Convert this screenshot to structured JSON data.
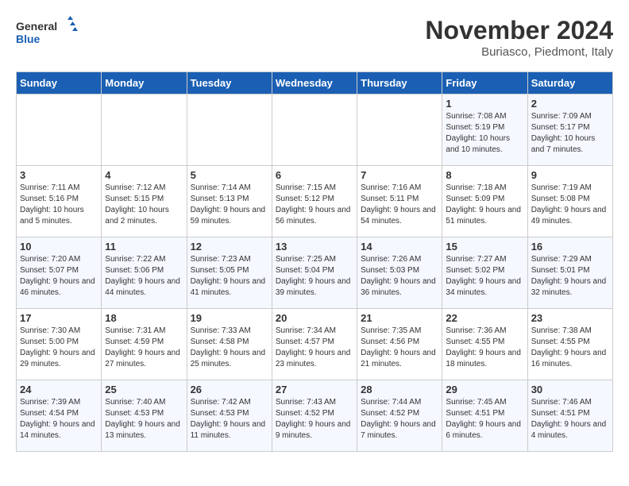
{
  "logo": {
    "line1": "General",
    "line2": "Blue"
  },
  "title": "November 2024",
  "location": "Buriasco, Piedmont, Italy",
  "days_of_week": [
    "Sunday",
    "Monday",
    "Tuesday",
    "Wednesday",
    "Thursday",
    "Friday",
    "Saturday"
  ],
  "weeks": [
    [
      {
        "day": "",
        "info": ""
      },
      {
        "day": "",
        "info": ""
      },
      {
        "day": "",
        "info": ""
      },
      {
        "day": "",
        "info": ""
      },
      {
        "day": "",
        "info": ""
      },
      {
        "day": "1",
        "info": "Sunrise: 7:08 AM\nSunset: 5:19 PM\nDaylight: 10 hours and 10 minutes."
      },
      {
        "day": "2",
        "info": "Sunrise: 7:09 AM\nSunset: 5:17 PM\nDaylight: 10 hours and 7 minutes."
      }
    ],
    [
      {
        "day": "3",
        "info": "Sunrise: 7:11 AM\nSunset: 5:16 PM\nDaylight: 10 hours and 5 minutes."
      },
      {
        "day": "4",
        "info": "Sunrise: 7:12 AM\nSunset: 5:15 PM\nDaylight: 10 hours and 2 minutes."
      },
      {
        "day": "5",
        "info": "Sunrise: 7:14 AM\nSunset: 5:13 PM\nDaylight: 9 hours and 59 minutes."
      },
      {
        "day": "6",
        "info": "Sunrise: 7:15 AM\nSunset: 5:12 PM\nDaylight: 9 hours and 56 minutes."
      },
      {
        "day": "7",
        "info": "Sunrise: 7:16 AM\nSunset: 5:11 PM\nDaylight: 9 hours and 54 minutes."
      },
      {
        "day": "8",
        "info": "Sunrise: 7:18 AM\nSunset: 5:09 PM\nDaylight: 9 hours and 51 minutes."
      },
      {
        "day": "9",
        "info": "Sunrise: 7:19 AM\nSunset: 5:08 PM\nDaylight: 9 hours and 49 minutes."
      }
    ],
    [
      {
        "day": "10",
        "info": "Sunrise: 7:20 AM\nSunset: 5:07 PM\nDaylight: 9 hours and 46 minutes."
      },
      {
        "day": "11",
        "info": "Sunrise: 7:22 AM\nSunset: 5:06 PM\nDaylight: 9 hours and 44 minutes."
      },
      {
        "day": "12",
        "info": "Sunrise: 7:23 AM\nSunset: 5:05 PM\nDaylight: 9 hours and 41 minutes."
      },
      {
        "day": "13",
        "info": "Sunrise: 7:25 AM\nSunset: 5:04 PM\nDaylight: 9 hours and 39 minutes."
      },
      {
        "day": "14",
        "info": "Sunrise: 7:26 AM\nSunset: 5:03 PM\nDaylight: 9 hours and 36 minutes."
      },
      {
        "day": "15",
        "info": "Sunrise: 7:27 AM\nSunset: 5:02 PM\nDaylight: 9 hours and 34 minutes."
      },
      {
        "day": "16",
        "info": "Sunrise: 7:29 AM\nSunset: 5:01 PM\nDaylight: 9 hours and 32 minutes."
      }
    ],
    [
      {
        "day": "17",
        "info": "Sunrise: 7:30 AM\nSunset: 5:00 PM\nDaylight: 9 hours and 29 minutes."
      },
      {
        "day": "18",
        "info": "Sunrise: 7:31 AM\nSunset: 4:59 PM\nDaylight: 9 hours and 27 minutes."
      },
      {
        "day": "19",
        "info": "Sunrise: 7:33 AM\nSunset: 4:58 PM\nDaylight: 9 hours and 25 minutes."
      },
      {
        "day": "20",
        "info": "Sunrise: 7:34 AM\nSunset: 4:57 PM\nDaylight: 9 hours and 23 minutes."
      },
      {
        "day": "21",
        "info": "Sunrise: 7:35 AM\nSunset: 4:56 PM\nDaylight: 9 hours and 21 minutes."
      },
      {
        "day": "22",
        "info": "Sunrise: 7:36 AM\nSunset: 4:55 PM\nDaylight: 9 hours and 18 minutes."
      },
      {
        "day": "23",
        "info": "Sunrise: 7:38 AM\nSunset: 4:55 PM\nDaylight: 9 hours and 16 minutes."
      }
    ],
    [
      {
        "day": "24",
        "info": "Sunrise: 7:39 AM\nSunset: 4:54 PM\nDaylight: 9 hours and 14 minutes."
      },
      {
        "day": "25",
        "info": "Sunrise: 7:40 AM\nSunset: 4:53 PM\nDaylight: 9 hours and 13 minutes."
      },
      {
        "day": "26",
        "info": "Sunrise: 7:42 AM\nSunset: 4:53 PM\nDaylight: 9 hours and 11 minutes."
      },
      {
        "day": "27",
        "info": "Sunrise: 7:43 AM\nSunset: 4:52 PM\nDaylight: 9 hours and 9 minutes."
      },
      {
        "day": "28",
        "info": "Sunrise: 7:44 AM\nSunset: 4:52 PM\nDaylight: 9 hours and 7 minutes."
      },
      {
        "day": "29",
        "info": "Sunrise: 7:45 AM\nSunset: 4:51 PM\nDaylight: 9 hours and 6 minutes."
      },
      {
        "day": "30",
        "info": "Sunrise: 7:46 AM\nSunset: 4:51 PM\nDaylight: 9 hours and 4 minutes."
      }
    ]
  ]
}
